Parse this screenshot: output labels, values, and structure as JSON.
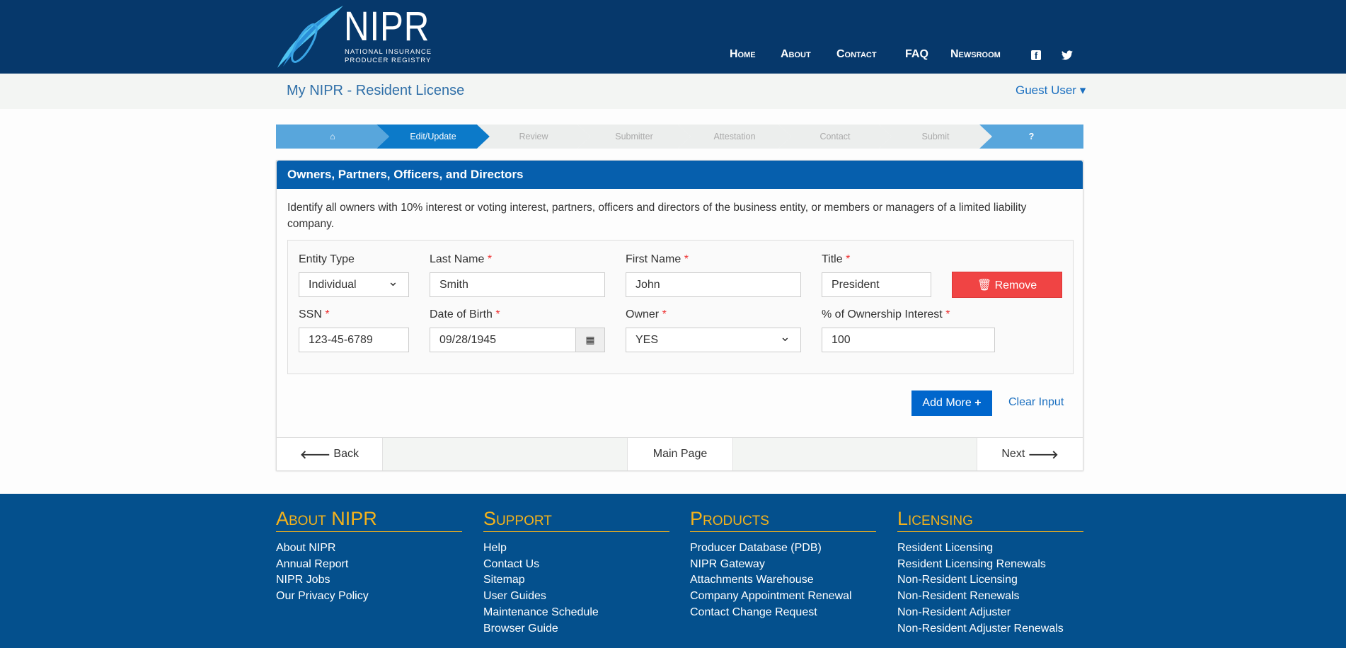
{
  "header": {
    "logo_word": "NIPR",
    "logo_sub": [
      "NATIONAL INSURANCE",
      "PRODUCER REGISTRY"
    ],
    "nav": [
      "Home",
      "About",
      "Contact",
      "FAQ",
      "Newsroom"
    ],
    "social": [
      "facebook-icon",
      "twitter-icon"
    ]
  },
  "subheader": {
    "title": "My NIPR - Resident License",
    "user": "Guest User"
  },
  "stepper": {
    "steps": [
      "",
      "Edit/Update",
      "Review",
      "Submitter",
      "Attestation",
      "Contact",
      "Submit",
      "?"
    ],
    "active": 1,
    "colors": {
      "active": "#0c7ac9",
      "light": "#58a6dc",
      "inactive": "#eceeed"
    }
  },
  "panel": {
    "title": "Owners, Partners, Officers, and Directors",
    "description": "Identify all owners with 10% interest or voting interest, partners, officers and directors of the business entity, or members or managers of a limited liability company.",
    "fields": {
      "entity_type": {
        "label": "Entity Type",
        "value": "Individual"
      },
      "last_name": {
        "label": "Last Name",
        "value": "Smith"
      },
      "first_name": {
        "label": "First Name",
        "value": "John"
      },
      "title": {
        "label": "Title",
        "value": "President"
      },
      "ssn": {
        "label": "SSN",
        "value": "123-45-6789"
      },
      "dob": {
        "label": "Date of Birth",
        "value": "09/28/1945"
      },
      "owner": {
        "label": "Owner",
        "value": "YES"
      },
      "pct": {
        "label": "% of Ownership Interest",
        "value": "100"
      }
    },
    "required_mark": "*",
    "remove": "Remove",
    "add_more": "Add More",
    "clear": "Clear Input",
    "back": "Back",
    "main": "Main Page",
    "next": "Next"
  },
  "footer": {
    "columns": [
      {
        "title": "About NIPR",
        "links": [
          "About NIPR",
          "Annual Report",
          "NIPR Jobs",
          "Our Privacy Policy"
        ]
      },
      {
        "title": "Support",
        "links": [
          "Help",
          "Contact Us",
          "Sitemap",
          "User Guides",
          "Maintenance Schedule",
          "Browser Guide"
        ]
      },
      {
        "title": "Products",
        "links": [
          "Producer Database (PDB)",
          "NIPR Gateway",
          "Attachments Warehouse",
          "Company Appointment Renewal",
          "Contact Change Request"
        ]
      },
      {
        "title": "Licensing",
        "links": [
          "Resident Licensing",
          "Resident Licensing Renewals",
          "Non-Resident Licensing",
          "Non-Resident Renewals",
          "Non-Resident Adjuster",
          "Non-Resident Adjuster Renewals"
        ]
      }
    ]
  }
}
